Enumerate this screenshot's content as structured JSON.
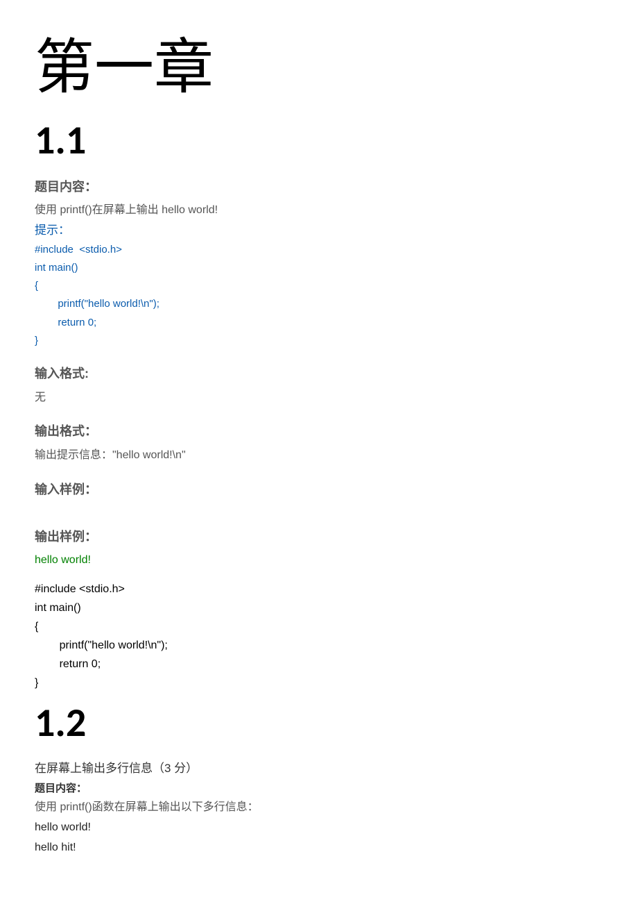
{
  "chapter": "第一章",
  "section1": {
    "number": "1.1",
    "labels": {
      "topic": "题目内容：",
      "hint": "提示：",
      "input_format": "输入格式:",
      "output_format": "输出格式：",
      "input_sample": "输入样例：",
      "output_sample": "输出样例："
    },
    "topic_text": "使用 printf()在屏幕上输出  hello world!",
    "hint_code": "#include  <stdio.h>\nint main()\n{\n        printf(\"hello world!\\n\");\n        return 0;\n}",
    "input_format_text": "无",
    "output_format_text": "输出提示信息：\"hello world!\\n\"",
    "output_sample_text": "hello world!",
    "solution_code": "#include <stdio.h>\nint main()\n{\n        printf(\"hello world!\\n\");\n        return 0;\n}"
  },
  "section2": {
    "number": "1.2",
    "title": "在屏幕上输出多行信息（3 分）",
    "labels": {
      "topic": "题目内容："
    },
    "topic_text": "使用 printf()函数在屏幕上输出以下多行信息：",
    "lines": [
      "hello world!",
      "hello hit!"
    ]
  }
}
